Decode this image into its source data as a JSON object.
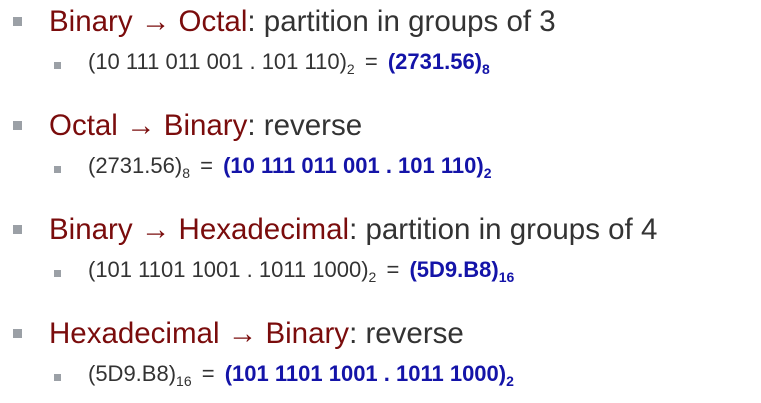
{
  "items": [
    {
      "heading_from": "Binary",
      "arrow": "→",
      "heading_to": "Octal",
      "heading_rest": ": partition in groups of 3",
      "expr_value": "(10 111 011 001 . 101 110)",
      "expr_base": "2",
      "equals": "=",
      "result_value": "(2731.56)",
      "result_base": "8"
    },
    {
      "heading_from": "Octal",
      "arrow": "→",
      "heading_to": "Binary",
      "heading_rest": ": reverse",
      "expr_value": "(2731.56)",
      "expr_base": "8",
      "equals": "=",
      "result_value": "(10 111 011 001 . 101 110)",
      "result_base": "2"
    },
    {
      "heading_from": "Binary",
      "arrow": "→",
      "heading_to": "Hexadecimal",
      "heading_rest": ": partition in groups of 4",
      "expr_value": "(101 1101 1001 . 1011 1000)",
      "expr_base": "2",
      "equals": "=",
      "result_value": "(5D9.B8)",
      "result_base": "16"
    },
    {
      "heading_from": "Hexadecimal",
      "arrow": "→",
      "heading_to": "Binary",
      "heading_rest": ": reverse",
      "expr_value": "(5D9.B8)",
      "expr_base": "16",
      "equals": "=",
      "result_value": "(101 1101 1001 . 1011 1000)",
      "result_base": "2"
    }
  ],
  "colors": {
    "heading_accent": "#7a0c0c",
    "body_text": "#333333",
    "result_text": "#1414a8",
    "bullet": "#9ba0a6"
  },
  "icons": {
    "level1_bullet": "square-bullet-icon",
    "level2_bullet": "small-square-bullet-icon"
  }
}
